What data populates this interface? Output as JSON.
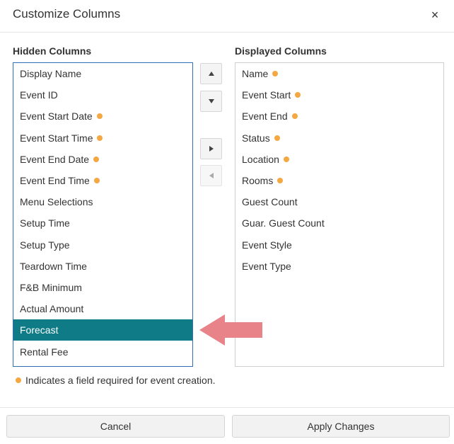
{
  "dialog": {
    "title": "Customize Columns",
    "close_symbol": "×"
  },
  "hidden": {
    "label": "Hidden Columns",
    "items": [
      {
        "label": "Display Name",
        "required": false
      },
      {
        "label": "Event ID",
        "required": false
      },
      {
        "label": "Event Start Date",
        "required": true
      },
      {
        "label": "Event Start Time",
        "required": true
      },
      {
        "label": "Event End Date",
        "required": true
      },
      {
        "label": "Event End Time",
        "required": true
      },
      {
        "label": "Menu Selections",
        "required": false
      },
      {
        "label": "Setup Time",
        "required": false
      },
      {
        "label": "Setup Type",
        "required": false
      },
      {
        "label": "Teardown Time",
        "required": false
      },
      {
        "label": "F&B Minimum",
        "required": false
      },
      {
        "label": "Actual Amount",
        "required": false
      },
      {
        "label": "Forecast",
        "required": false,
        "selected": true
      },
      {
        "label": "Rental Fee",
        "required": false
      }
    ]
  },
  "displayed": {
    "label": "Displayed Columns",
    "items": [
      {
        "label": "Name",
        "required": true
      },
      {
        "label": "Event Start",
        "required": true
      },
      {
        "label": "Event End",
        "required": true
      },
      {
        "label": "Status",
        "required": true
      },
      {
        "label": "Location",
        "required": true
      },
      {
        "label": "Rooms",
        "required": true
      },
      {
        "label": "Guest Count",
        "required": false
      },
      {
        "label": "Guar. Guest Count",
        "required": false
      },
      {
        "label": "Event Style",
        "required": false
      },
      {
        "label": "Event Type",
        "required": false
      }
    ]
  },
  "icons": {
    "move_up": "triangle-up-icon",
    "move_down": "triangle-down-icon",
    "move_right": "triangle-right-icon",
    "move_left": "triangle-left-icon",
    "annotation": "pointer-arrow-icon"
  },
  "footnote": {
    "text": "Indicates a field required for event creation."
  },
  "footer": {
    "cancel_label": "Cancel",
    "apply_label": "Apply Changes"
  },
  "colors": {
    "selected_bg": "#0e7b86",
    "required_dot": "#f5a742",
    "annotation_arrow": "#e8838a",
    "hidden_list_border": "#2f6fb5"
  }
}
